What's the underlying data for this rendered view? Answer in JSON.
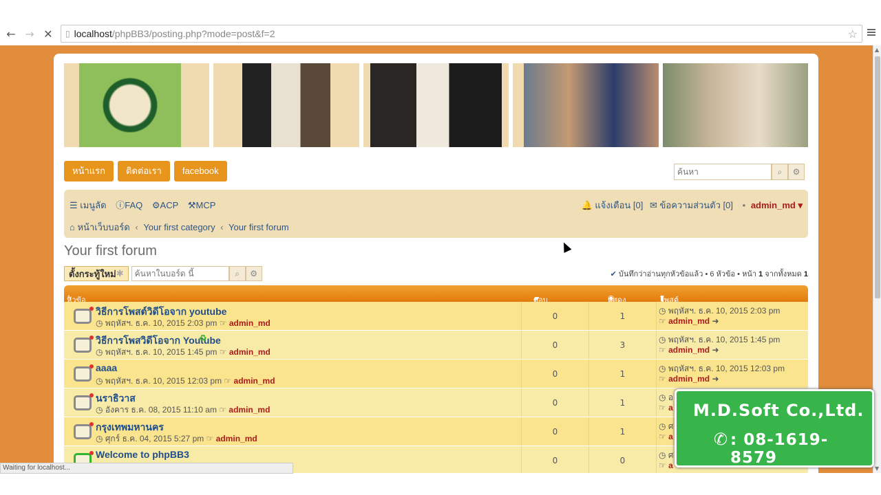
{
  "browser": {
    "url_host": "localhost",
    "url_path": "/phpBB3/posting.php?mode=post&f=2",
    "status_text": "Waiting for localhost..."
  },
  "nav_tabs": [
    "หน้าแรก",
    "ติดต่อเรา",
    "facebook"
  ],
  "top_search": {
    "placeholder": "ค้นหา"
  },
  "quick_links": {
    "menu": "เมนูลัด",
    "faq": "FAQ",
    "acp": "ACP",
    "mcp": "MCP",
    "notifications": "แจ้งเตือน [0]",
    "messages": "ข้อความส่วนตัว [0]",
    "user": "admin_md"
  },
  "breadcrumb": {
    "home": "หน้าเว็บบอร์ด",
    "category": "Your first category",
    "forum": "Your first forum"
  },
  "page_title": "Your first forum",
  "actions": {
    "new_topic": "ตั้งกระทู้ใหม่",
    "forum_search_placeholder": "ค้นหาในบอร์ด นี้",
    "page_info_prefix": "บันทึกว่าอ่านทุกหัวข้อแล้ว • 6 หัวข้อ • หน้า ",
    "page_current": "1",
    "page_middle": " จากทั้งหมด ",
    "page_total": "1"
  },
  "table": {
    "headers": {
      "topic": "หัวข้อ",
      "replies": "ตอบกลับ",
      "views": "แสดง",
      "last_post": "โพสต์ล่าสุด"
    },
    "rows": [
      {
        "title": "วิธีการโพสต์วิดีโอจาก youtube",
        "date": "พฤหัสฯ. ธ.ค. 10, 2015 2:03 pm",
        "author": "admin_md",
        "replies": "0",
        "views": "1",
        "last_date": "พฤหัสฯ. ธ.ค. 10, 2015 2:03 pm",
        "last_author": "admin_md"
      },
      {
        "title": "วิธีการโพสวิดีโอจาก Youtube",
        "date": "พฤหัสฯ. ธ.ค. 10, 2015 1:45 pm",
        "author": "admin_md",
        "replies": "0",
        "views": "3",
        "last_date": "พฤหัสฯ. ธ.ค. 10, 2015 1:45 pm",
        "last_author": "admin_md"
      },
      {
        "title": "aaaa",
        "date": "พฤหัสฯ. ธ.ค. 10, 2015 12:03 pm",
        "author": "admin_md",
        "replies": "0",
        "views": "1",
        "last_date": "พฤหัสฯ. ธ.ค. 10, 2015 12:03 pm",
        "last_author": "admin_md"
      },
      {
        "title": "นราธิวาส",
        "date": "อังคาร ธ.ค. 08, 2015 11:10 am",
        "author": "admin_md",
        "replies": "0",
        "views": "1",
        "last_date": "อ",
        "last_author": "a"
      },
      {
        "title": "กรุงเทพมหานคร",
        "date": "ศุกร์ ธ.ค. 04, 2015 5:27 pm",
        "author": "admin_md",
        "replies": "0",
        "views": "1",
        "last_date": "ศ",
        "last_author": "a"
      },
      {
        "title": "Welcome to phpBB3",
        "date": "",
        "author": "",
        "replies": "0",
        "views": "0",
        "last_date": "ศ",
        "last_author": "a"
      }
    ]
  },
  "overlay": {
    "company": "M.D.Soft Co.,Ltd.",
    "phone": ": 08-1619-8579"
  },
  "colors": {
    "page_bg": "#e28d3c",
    "tab": "#e8951e",
    "row": "#fbe48e",
    "link": "#1f4d8a",
    "user": "#aa1c1c",
    "overlay": "#37b54a"
  }
}
